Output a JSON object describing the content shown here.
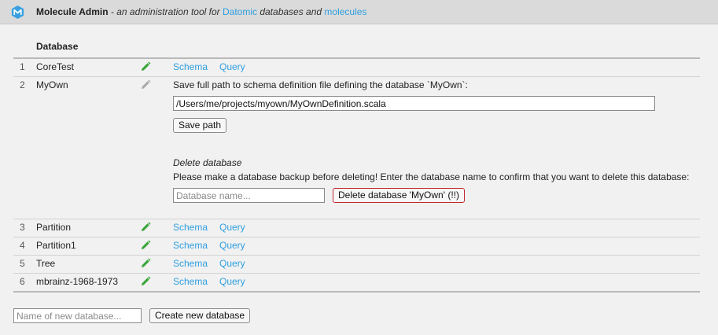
{
  "header": {
    "app_name": "Molecule Admin",
    "tagline_prefix": " - an administration tool for ",
    "datomic_link": "Datomic",
    "tagline_middle": " databases and ",
    "molecules_link": "molecules"
  },
  "table": {
    "column_header": "Database",
    "rows": [
      {
        "num": "1",
        "name": "CoreTest",
        "schema": "Schema",
        "query": "Query"
      },
      {
        "num": "2",
        "name": "MyOwn"
      },
      {
        "num": "3",
        "name": "Partition",
        "schema": "Schema",
        "query": "Query"
      },
      {
        "num": "4",
        "name": "Partition1",
        "schema": "Schema",
        "query": "Query"
      },
      {
        "num": "5",
        "name": "Tree",
        "schema": "Schema",
        "query": "Query"
      },
      {
        "num": "6",
        "name": "mbrainz-1968-1973",
        "schema": "Schema",
        "query": "Query"
      }
    ]
  },
  "edit_panel": {
    "prompt": "Save full path to schema definition file defining the database `MyOwn`:",
    "path_value": "/Users/me/projects/myown/MyOwnDefinition.scala",
    "save_label": "Save path",
    "delete_title": "Delete database",
    "delete_warning": "Please make a database backup before deleting! Enter the database name to confirm that you want to delete this database:",
    "delete_placeholder": "Database name...",
    "delete_button": "Delete database 'MyOwn' (!!)"
  },
  "footer": {
    "new_db_placeholder": "Name of new database...",
    "create_button": "Create new database"
  },
  "colors": {
    "link": "#2e9fe0",
    "pencil_active": "#3aa53a",
    "pencil_inactive": "#a9a9a9",
    "danger": "#c0272d"
  }
}
